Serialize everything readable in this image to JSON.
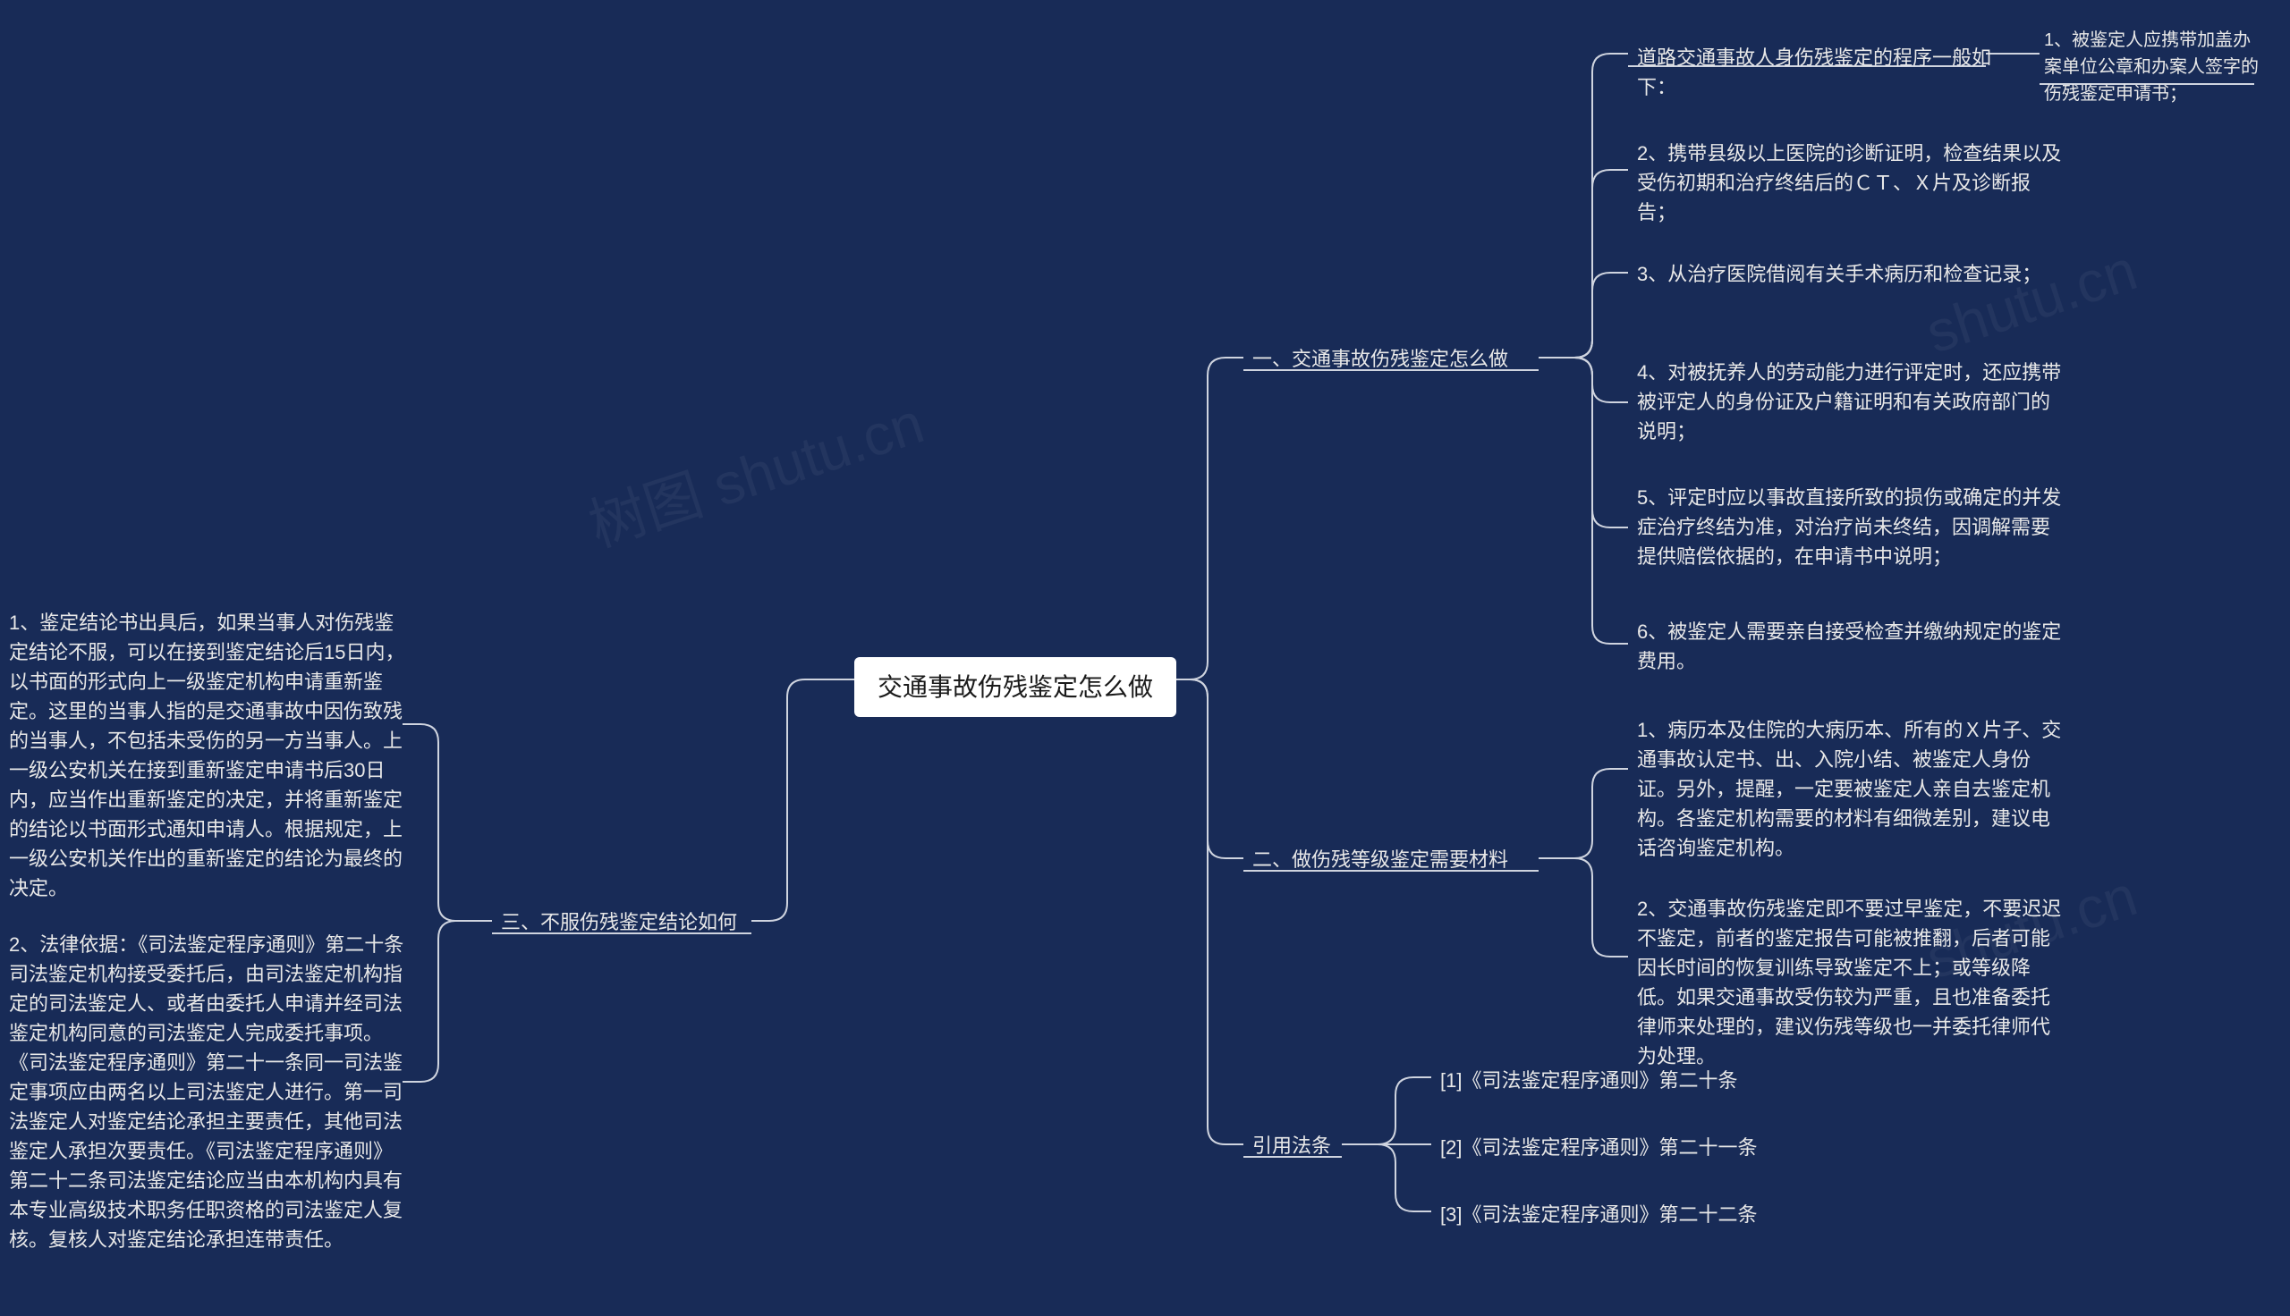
{
  "center": {
    "title": "交通事故伤残鉴定怎么做"
  },
  "branches": {
    "b1": {
      "label": "一、交通事故伤残鉴定怎么做",
      "items": {
        "i0": "道路交通事故人身伤残鉴定的程序一般如下：",
        "i0b": "1、被鉴定人应携带加盖办案单位公章和办案人签字的伤残鉴定申请书；",
        "i1": "2、携带县级以上医院的诊断证明，检查结果以及受伤初期和治疗终结后的ＣＴ、Ｘ片及诊断报告；",
        "i2": "3、从治疗医院借阅有关手术病历和检查记录；",
        "i3": "4、对被抚养人的劳动能力进行评定时，还应携带被评定人的身份证及户籍证明和有关政府部门的说明；",
        "i4": "5、评定时应以事故直接所致的损伤或确定的并发症治疗终结为准，对治疗尚未终结，因调解需要提供赔偿依据的，在申请书中说明；",
        "i5": "6、被鉴定人需要亲自接受检查并缴纳规定的鉴定费用。"
      }
    },
    "b2": {
      "label": "二、做伤残等级鉴定需要材料",
      "items": {
        "i0": "1、病历本及住院的大病历本、所有的Ｘ片子、交通事故认定书、出、入院小结、被鉴定人身份证。另外，提醒，一定要被鉴定人亲自去鉴定机构。各鉴定机构需要的材料有细微差别，建议电话咨询鉴定机构。",
        "i1": "2、交通事故伤残鉴定即不要过早鉴定，不要迟迟不鉴定，前者的鉴定报告可能被推翻，后者可能因长时间的恢复训练导致鉴定不上；或等级降低。如果交通事故受伤较为严重，且也准备委托律师来处理的，建议伤残等级也一并委托律师代为处理。"
      }
    },
    "b3": {
      "label": "引用法条",
      "items": {
        "i0": "[1]《司法鉴定程序通则》第二十条",
        "i1": "[2]《司法鉴定程序通则》第二十一条",
        "i2": "[3]《司法鉴定程序通则》第二十二条"
      }
    },
    "b4": {
      "label": "三、不服伤残鉴定结论如何",
      "items": {
        "i0": "1、鉴定结论书出具后，如果当事人对伤残鉴定结论不服，可以在接到鉴定结论后15日内，以书面的形式向上一级鉴定机构申请重新鉴定。这里的当事人指的是交通事故中因伤致残的当事人，不包括未受伤的另一方当事人。上一级公安机关在接到重新鉴定申请书后30日内，应当作出重新鉴定的决定，并将重新鉴定的结论以书面形式通知申请人。根据规定，上一级公安机关作出的重新鉴定的结论为最终的决定。",
        "i1": "2、法律依据：《司法鉴定程序通则》第二十条司法鉴定机构接受委托后，由司法鉴定机构指定的司法鉴定人、或者由委托人申请并经司法鉴定机构同意的司法鉴定人完成委托事项。《司法鉴定程序通则》第二十一条同一司法鉴定事项应由两名以上司法鉴定人进行。第一司法鉴定人对鉴定结论承担主要责任，其他司法鉴定人承担次要责任。《司法鉴定程序通则》第二十二条司法鉴定结论应当由本机构内具有本专业高级技术职务任职资格的司法鉴定人复核。复核人对鉴定结论承担连带责任。"
      }
    }
  },
  "watermarks": {
    "w1": "树图 shutu.cn",
    "w2": "shutu.cn"
  }
}
